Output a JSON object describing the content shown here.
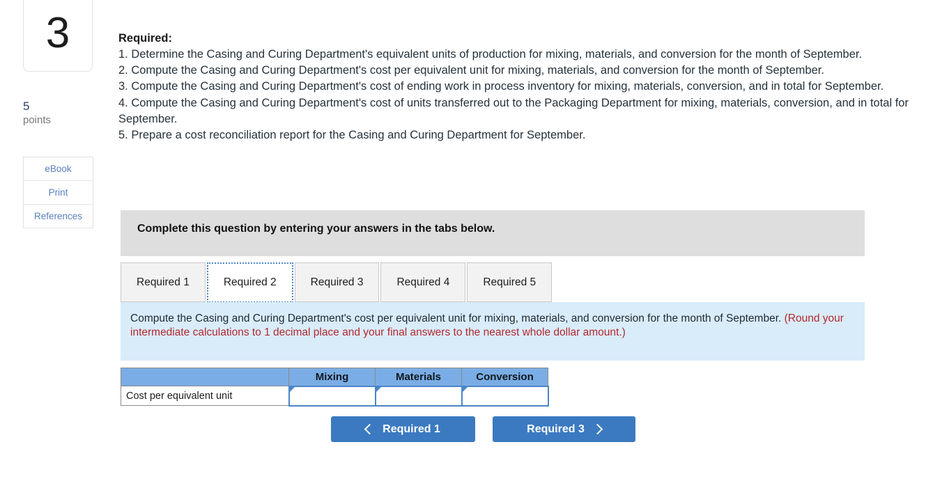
{
  "sidebar": {
    "question_number": "3",
    "points_value": "5",
    "points_label": "points",
    "tools": [
      {
        "label": "eBook"
      },
      {
        "label": "Print"
      },
      {
        "label": "References"
      }
    ]
  },
  "main": {
    "required_heading": "Required:",
    "requirements": [
      "1. Determine the Casing and Curing Department's equivalent units of production for mixing, materials, and conversion for the month of September.",
      "2. Compute the Casing and Curing Department's cost per equivalent unit for mixing, materials, and conversion for the month of September.",
      "3. Compute the Casing and Curing Department's cost of ending work in process inventory for mixing, materials, conversion, and in total for September.",
      "4. Compute the Casing and Curing Department's cost of units transferred out to the Packaging Department for mixing, materials, conversion, and in total for September.",
      "5. Prepare a cost reconciliation report for the Casing and Curing Department for September."
    ],
    "banner_text": "Complete this question by entering your answers in the tabs below.",
    "tabs": [
      {
        "label": "Required 1",
        "active": false
      },
      {
        "label": "Required 2",
        "active": true
      },
      {
        "label": "Required 3",
        "active": false
      },
      {
        "label": "Required 4",
        "active": false
      },
      {
        "label": "Required 5",
        "active": false
      }
    ],
    "panel": {
      "text_black": "Compute the Casing and Curing Department's cost per equivalent unit for mixing, materials, and conversion for the month of September.",
      "text_red": "(Round your intermediate calculations to 1 decimal place and your final answers to the nearest whole dollar amount.)"
    },
    "table": {
      "header_blank": "",
      "headers": [
        "Mixing",
        "Materials",
        "Conversion"
      ],
      "rows": [
        {
          "label": "Cost per equivalent unit",
          "values": [
            "",
            "",
            ""
          ]
        }
      ]
    },
    "nav": {
      "prev_label": "Required 1",
      "next_label": "Required 3"
    }
  },
  "colors": {
    "button_blue": "#3b7ac0",
    "table_header_blue": "#7aade5",
    "panel_blue": "#d9ecfa",
    "banner_gray": "#dedede",
    "red_text": "#b3292f",
    "link_blue": "#5a7fbf"
  }
}
